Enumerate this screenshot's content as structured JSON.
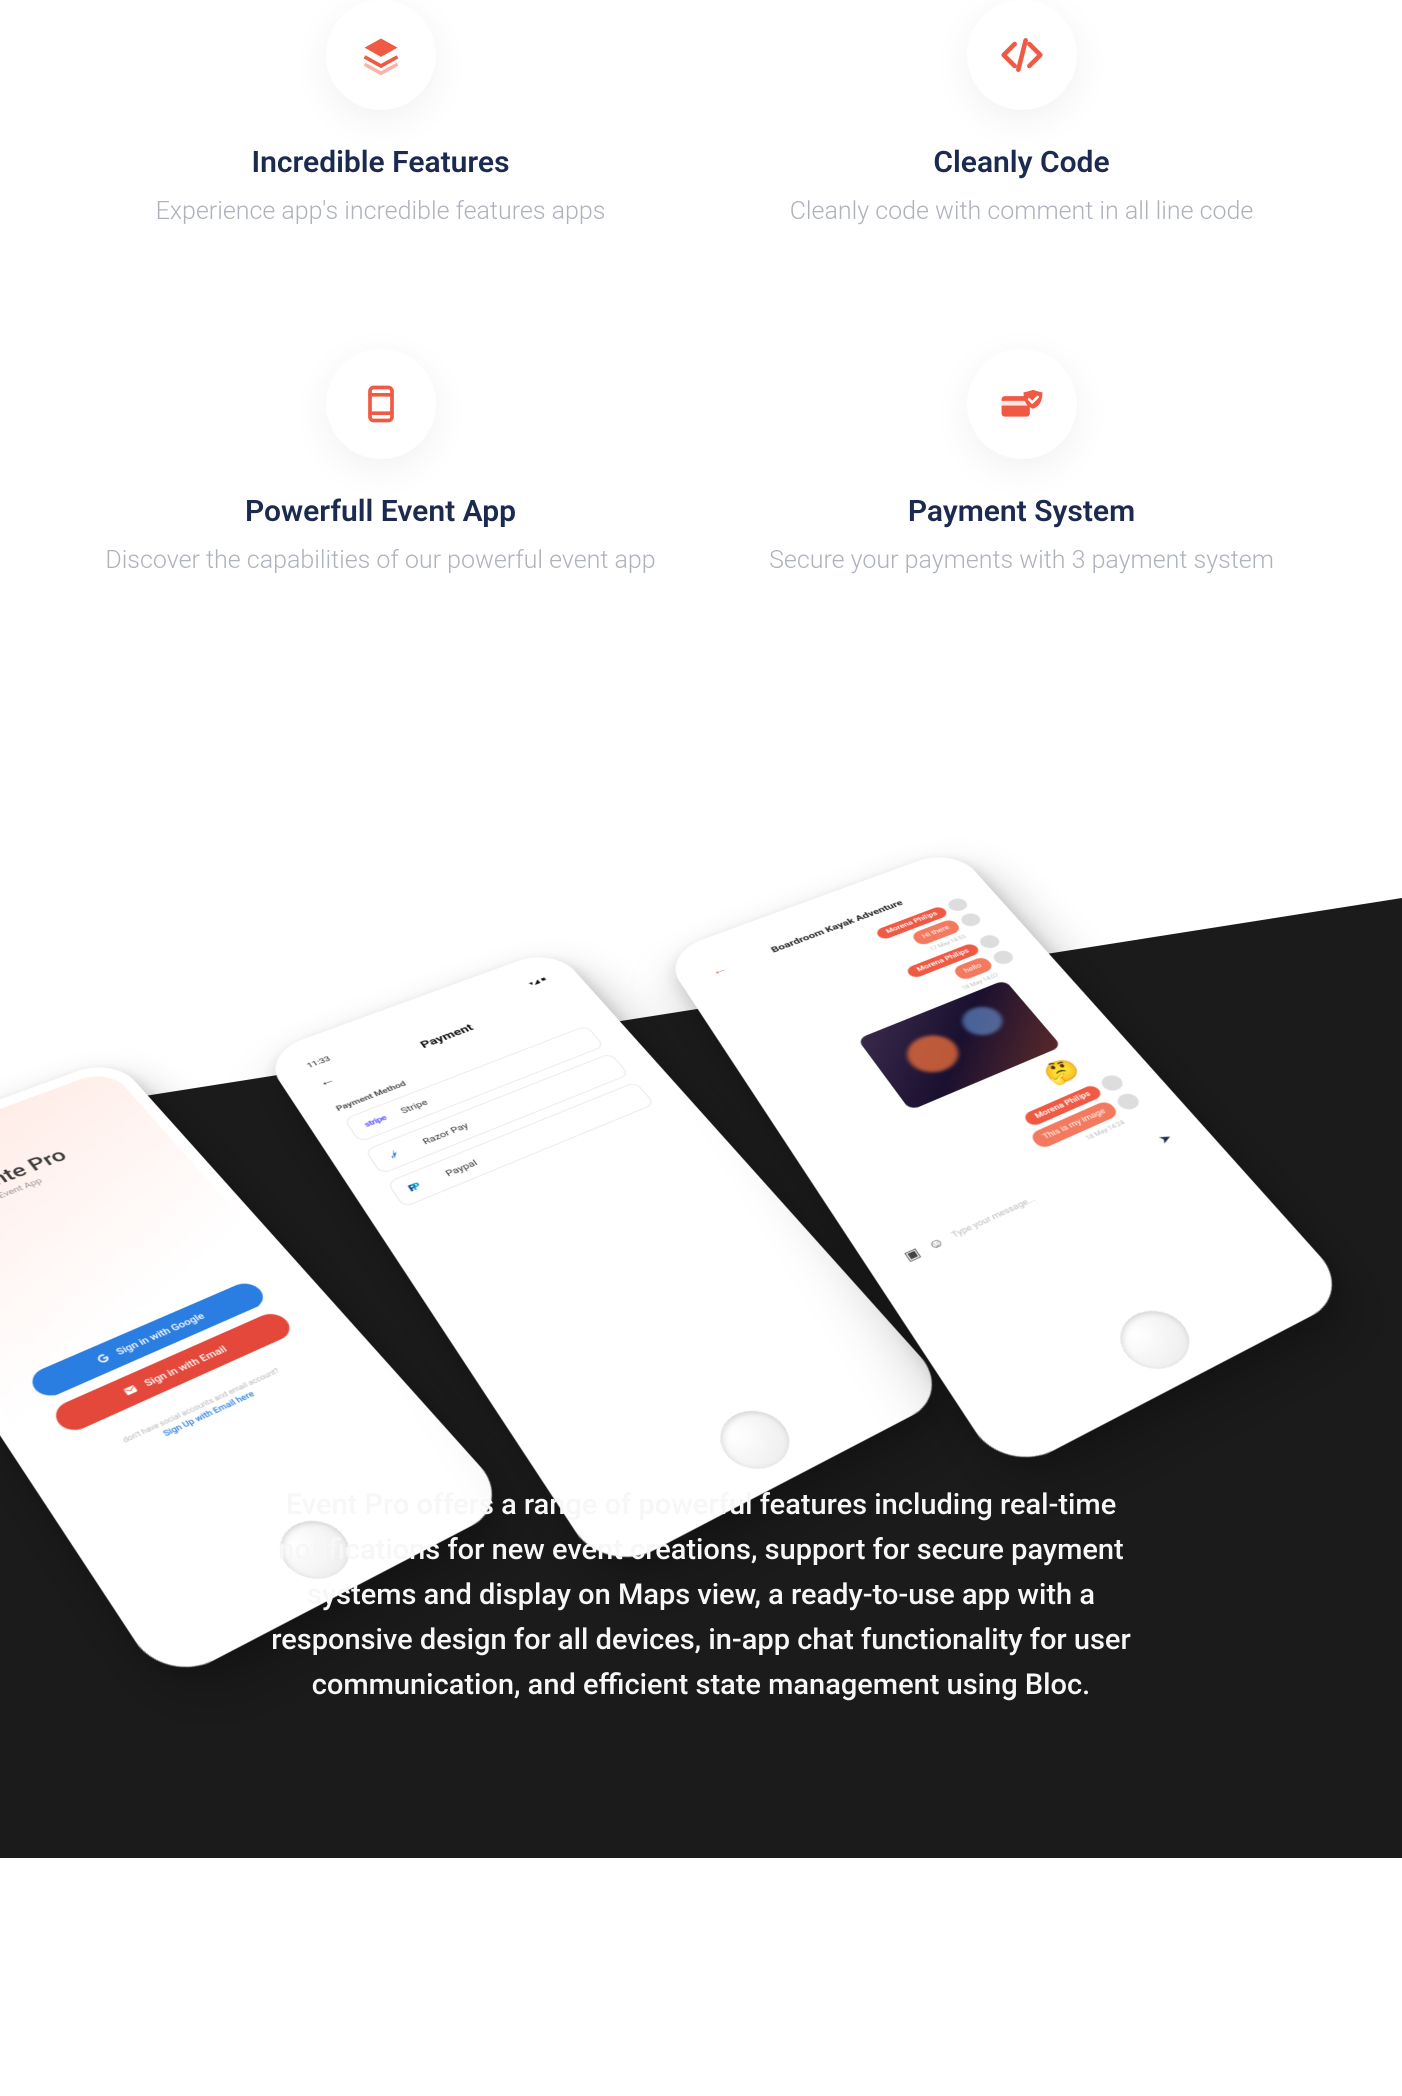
{
  "features": [
    {
      "title": "Incredible Features",
      "desc": "Experience app's incredible features apps",
      "icon": "layers"
    },
    {
      "title": "Cleanly Code",
      "desc": "Cleanly code with comment in all line code",
      "icon": "code"
    },
    {
      "title": "Powerfull Event App",
      "desc": "Discover the capabilities of our powerful event app",
      "icon": "device"
    },
    {
      "title": "Payment System",
      "desc": "Secure your payments with 3 payment system",
      "icon": "payment-shield"
    }
  ],
  "accent_color": "#f05a44",
  "phone1": {
    "brand_name": "Evente Pro",
    "brand_sub": "Mobile Event App",
    "btn_google": "Sign in with Google",
    "btn_email": "Sign in with Email",
    "signup_line": "don't have social accounts and email account?",
    "signup_link": "Sign Up with Email here"
  },
  "phone2": {
    "time": "11:33",
    "title": "Payment",
    "method_label": "Payment Method",
    "methods": [
      {
        "name": "Stripe"
      },
      {
        "name": "Razor Pay"
      },
      {
        "name": "Paypal"
      }
    ]
  },
  "phone3": {
    "title": "Boardroom Kayak Adventure",
    "sender": "Morena Philips",
    "msg1": "Hi there",
    "time1": "17 May  14:53",
    "msg2": "hello",
    "time2": "18 May  14:07",
    "msg3": "This is my image",
    "time3": "18 May 14:24",
    "input_placeholder": "Type your message...",
    "emoji": "🤔"
  },
  "hero_paragraph": "Event Pro offers a range of powerful features including real-time notifications for new event creations, support for secure payment systems and display on Maps view, a ready-to-use app with a responsive design for all devices, in-app chat functionality for user communication, and efficient state management using Bloc."
}
